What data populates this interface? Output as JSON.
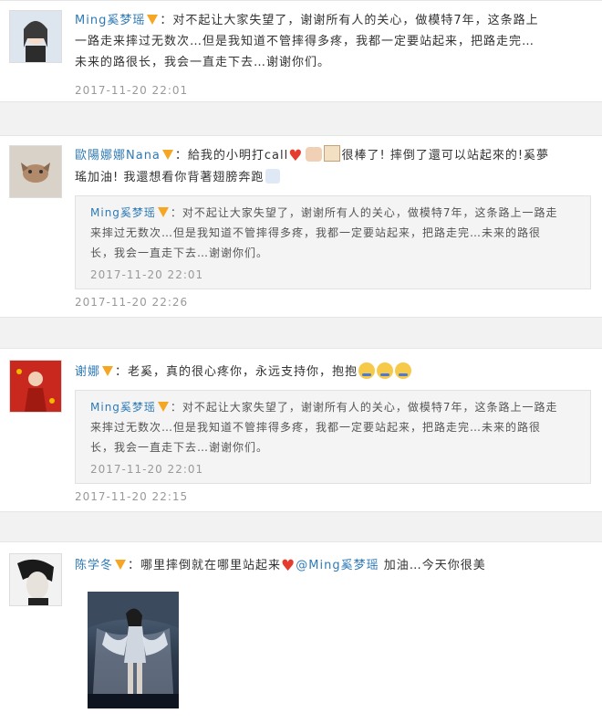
{
  "comments": [
    {
      "user": "Ming奚梦瑶",
      "text_lines": [
        "：对不起让大家失望了，谢谢所有人的关心，做模特7年，这条路上",
        "一路走来摔过无数次…但是我知道不管摔得多疼，我都一定要站起来，把路走完…",
        "未来的路很长，我会一直走下去…谢谢你们。"
      ],
      "time": "2017-11-20 22:01"
    },
    {
      "user": "歐陽娜娜Nana",
      "text_lines": [
        "：給我的小明打call",
        "很棒了! 摔倒了還可以站起來的!奚夢",
        "瑤加油! 我還想看你背著翅膀奔跑"
      ],
      "quote": {
        "user": "Ming奚梦瑶",
        "text_lines": [
          "：对不起让大家失望了，谢谢所有人的关心，做模特7年，这条路上一路走",
          "来摔过无数次…但是我知道不管摔得多疼，我都一定要站起来，把路走完…未来的路很",
          "长，我会一直走下去…谢谢你们。"
        ],
        "time": "2017-11-20 22:01"
      },
      "time": "2017-11-20 22:26"
    },
    {
      "user": "谢娜",
      "text_lines": [
        "：老奚，真的很心疼你，永远支持你，抱抱"
      ],
      "quote": {
        "user": "Ming奚梦瑶",
        "text_lines": [
          "：对不起让大家失望了，谢谢所有人的关心，做模特7年，这条路上一路走",
          "来摔过无数次…但是我知道不管摔得多疼，我都一定要站起来，把路走完…未来的路很",
          "长，我会一直走下去…谢谢你们。"
        ],
        "time": "2017-11-20 22:01"
      },
      "time": "2017-11-20 22:15"
    },
    {
      "user": "陈学冬",
      "text_lines": [
        "：哪里摔倒就在哪里站起来",
        "@Ming奚梦瑶",
        " 加油…今天你很美"
      ]
    }
  ],
  "icons": {
    "verified_badge": "verified-v-icon",
    "heart": "heart-icon",
    "hug_emoji": "hug-emoji-icon"
  },
  "colors": {
    "link": "#2e7ab6",
    "badge": "#f5a623",
    "timestamp": "#999999",
    "quote_bg": "#f4f4f4"
  }
}
